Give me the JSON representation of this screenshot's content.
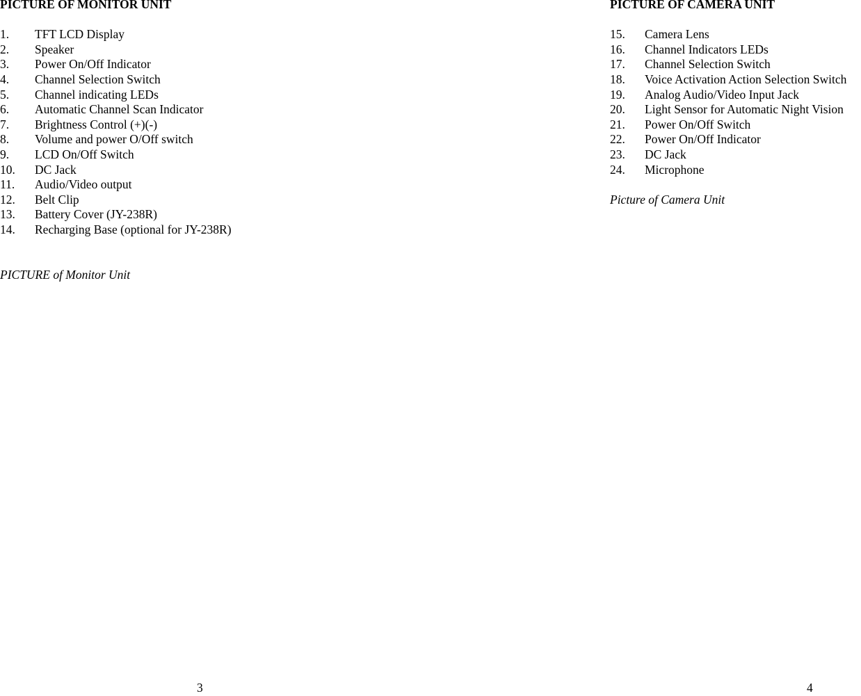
{
  "monitor": {
    "title": "PICTURE OF MONITOR UNIT",
    "items": [
      {
        "num": "1.",
        "label": "TFT LCD Display"
      },
      {
        "num": "2.",
        "label": "Speaker"
      },
      {
        "num": "3.",
        "label": "Power On/Off Indicator"
      },
      {
        "num": "4.",
        "label": "Channel Selection Switch"
      },
      {
        "num": "5.",
        "label": "Channel indicating LEDs"
      },
      {
        "num": "6.",
        "label": "Automatic Channel Scan Indicator"
      },
      {
        "num": "7.",
        "label": "Brightness Control (+)(-)"
      },
      {
        "num": "8.",
        "label": "Volume and power O/Off switch"
      },
      {
        "num": "9.",
        "label": "LCD On/Off Switch"
      },
      {
        "num": "10.",
        "label": "DC Jack"
      },
      {
        "num": "11.",
        "label": "Audio/Video output"
      },
      {
        "num": "12.",
        "label": "Belt Clip"
      },
      {
        "num": "13.",
        "label": "Battery Cover (JY-238R)"
      },
      {
        "num": "14.",
        "label": "Recharging Base (optional for JY-238R)"
      }
    ],
    "caption": "PICTURE of Monitor Unit",
    "page_number": "3"
  },
  "camera": {
    "title": "PICTURE OF CAMERA UNIT",
    "items": [
      {
        "num": "15.",
        "label": "Camera Lens"
      },
      {
        "num": "16.",
        "label": "Channel Indicators LEDs"
      },
      {
        "num": "17.",
        "label": "Channel Selection Switch"
      },
      {
        "num": "18.",
        "label": "Voice Activation Action Selection Switch"
      },
      {
        "num": "19.",
        "label": "Analog Audio/Video Input Jack"
      },
      {
        "num": "20.",
        "label": "Light Sensor for Automatic Night Vision"
      },
      {
        "num": "21.",
        "label": "Power On/Off Switch"
      },
      {
        "num": "22.",
        "label": "Power On/Off Indicator"
      },
      {
        "num": "23.",
        "label": "DC Jack"
      },
      {
        "num": "24.",
        "label": "Microphone"
      }
    ],
    "caption": "Picture of Camera Unit",
    "page_number": "4"
  }
}
